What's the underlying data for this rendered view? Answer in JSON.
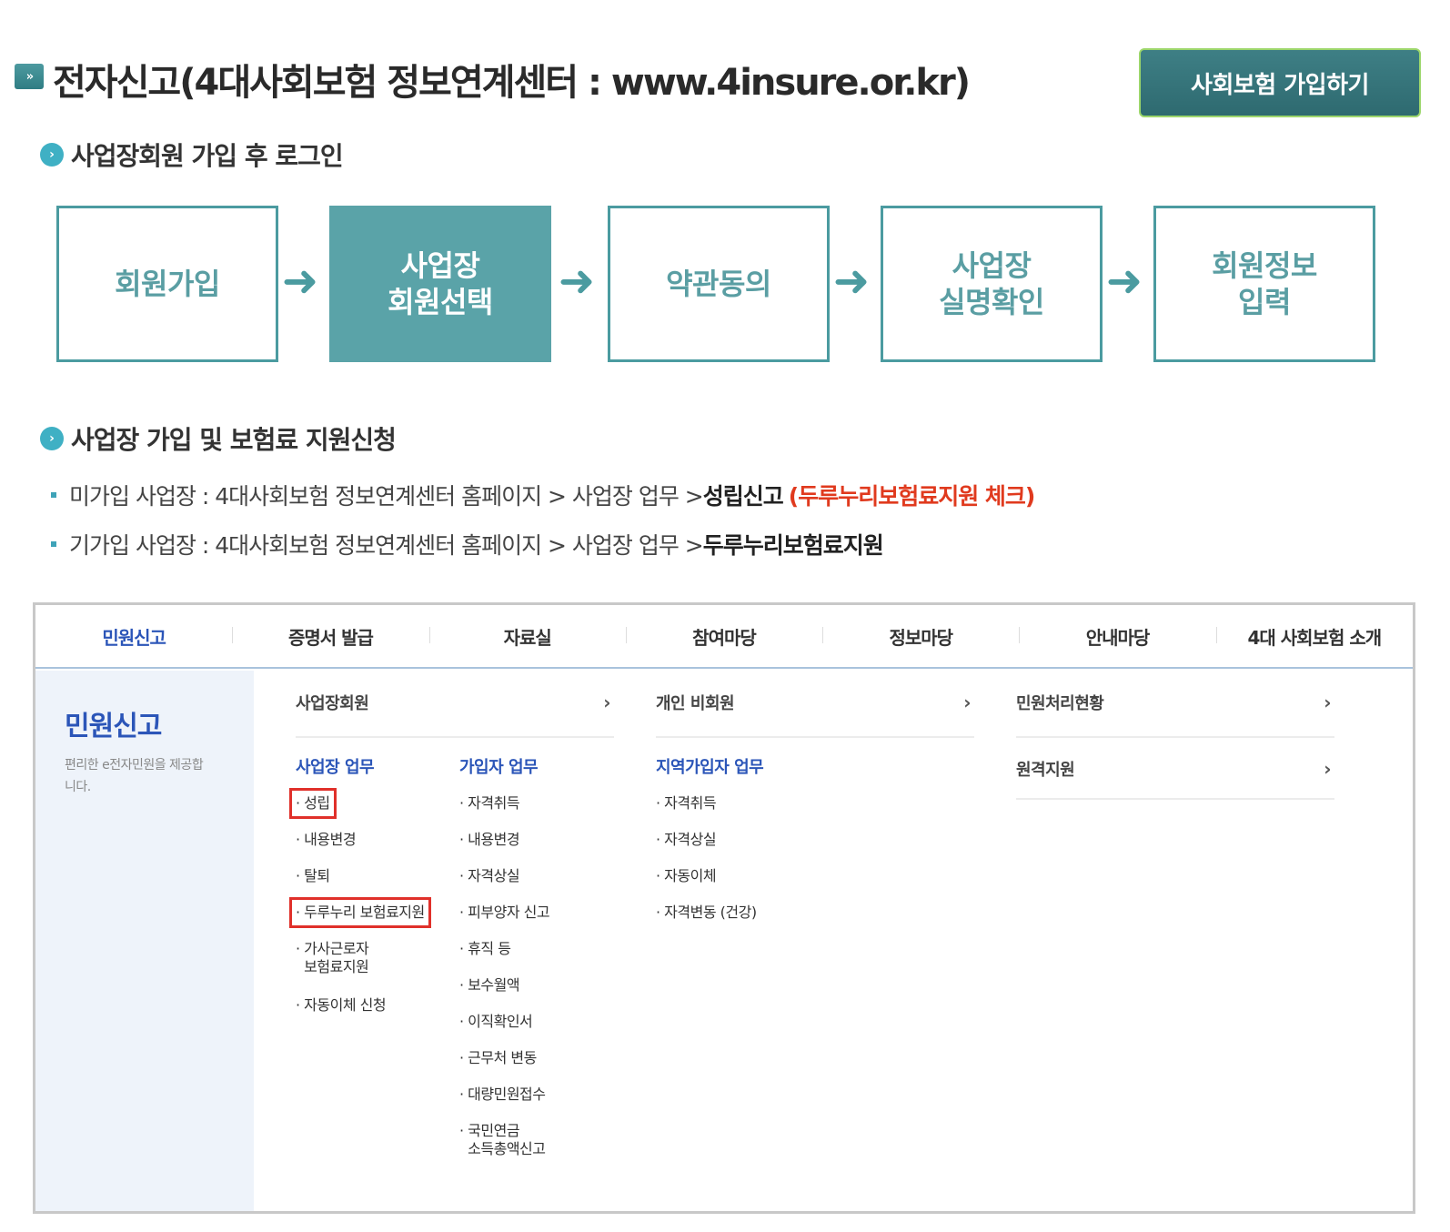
{
  "header": {
    "icon": "»",
    "title": "전자신고(4대사회보험 정보연계센터 : www.4insure.or.kr)",
    "join_button": "사회보험 가입하기"
  },
  "section1": {
    "bullet": "›",
    "title": "사업장회원 가입 후 로그인"
  },
  "steps": [
    {
      "label": "회원가입"
    },
    {
      "label": "사업장\n회원선택"
    },
    {
      "label": "약관동의"
    },
    {
      "label": "사업장\n실명확인"
    },
    {
      "label": "회원정보\n입력"
    }
  ],
  "arrow": "➜",
  "section2": {
    "bullet": "›",
    "title": "사업장 가입 및 보험료 지원신청"
  },
  "lines": [
    {
      "prefix": "미가입 사업장 : 4대사회보험 정보연계센터 홈페이지 > 사업장 업무 > ",
      "bold": "성립신고",
      "red": "(두루누리보험료지원 체크)"
    },
    {
      "prefix": "기가입 사업장 : 4대사회보험 정보연계센터 홈페이지 > 사업장 업무 > ",
      "bold": "두루누리보험료지원",
      "red": ""
    }
  ],
  "panel": {
    "gnb": [
      "민원신고",
      "증명서 발급",
      "자료실",
      "참여마당",
      "정보마당",
      "안내마당",
      "4대 사회보험 소개"
    ],
    "lnb_title": "민원신고",
    "lnb_desc": "편리한 e전자민원을 제공합니다.",
    "menu_rows": [
      {
        "label": "사업장회원",
        "chev": "›"
      },
      {
        "label": "개인 비회원",
        "chev": "›"
      },
      {
        "label": "민원처리현황",
        "chev": "›"
      },
      {
        "label": "원격지원",
        "chev": "›"
      }
    ],
    "col1_head": "사업장 업무",
    "col1": [
      "· 성립",
      "· 내용변경",
      "· 탈퇴",
      "· 두루누리 보험료지원",
      "· 가사근로자\n  보험료지원",
      "· 자동이체 신청"
    ],
    "col2_head": "가입자 업무",
    "col2": [
      "· 자격취득",
      "· 내용변경",
      "· 자격상실",
      "· 피부양자 신고",
      "· 휴직 등",
      "· 보수월액",
      "· 이직확인서",
      "· 근무처 변동",
      "· 대량민원접수",
      "· 국민연금\n  소득총액신고"
    ],
    "col3_head": "지역가입자 업무",
    "col3": [
      "· 자격취득",
      "· 자격상실",
      "· 자동이체",
      "· 자격변동 (건강)"
    ]
  }
}
